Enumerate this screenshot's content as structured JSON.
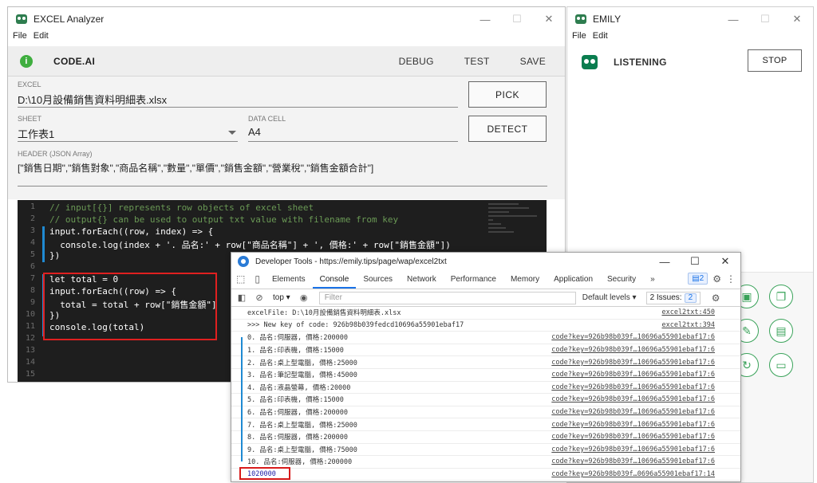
{
  "excel": {
    "title": "EXCEL Analyzer",
    "menu": [
      "File",
      "Edit"
    ],
    "toolbar": {
      "brand": "CODE.AI",
      "debug": "DEBUG",
      "test": "TEST",
      "save": "SAVE"
    },
    "form": {
      "excel_label": "EXCEL",
      "excel_value": "D:\\10月設備銷售資料明細表.xlsx",
      "sheet_label": "SHEET",
      "sheet_value": "工作表1",
      "datacell_label": "DATA CELL",
      "datacell_value": "A4",
      "header_label": "HEADER (JSON Array)",
      "header_value": "[\"銷售日期\",\"銷售對象\",\"商品名稱\",\"數量\",\"單價\",\"銷售金額\",\"營業稅\",\"銷售金額合計\"]",
      "pick_button": "PICK",
      "detect_button": "DETECT"
    },
    "code_lines": [
      "// input[{}] represents row objects of excel sheet",
      "// output{} can be used to output txt value with filename from key",
      "input.forEach((row, index) => {",
      "  console.log(index + '. 品名:' + row[\"商品名稱\"] + ', 價格:' + row[\"銷售金額\"])",
      "})",
      "",
      "let total = 0",
      "input.forEach((row) => {",
      "  total = total + row[\"銷售金額\"]",
      "})",
      "console.log(total)",
      "",
      "",
      "",
      ""
    ],
    "line_numbers": [
      "1",
      "2",
      "3",
      "4",
      "5",
      "6",
      "7",
      "8",
      "9",
      "10",
      "11",
      "12",
      "13",
      "14",
      "15"
    ]
  },
  "emily": {
    "title": "EMILY",
    "menu": [
      "File",
      "Edit"
    ],
    "status": "LISTENING",
    "stop_button": "STOP"
  },
  "devtools": {
    "title": "Developer Tools - https://emily.tips/page/wap/excel2txt",
    "tabs": [
      "Elements",
      "Console",
      "Sources",
      "Network",
      "Performance",
      "Memory",
      "Application",
      "Security"
    ],
    "more_tabs": "»",
    "issues_badge": "2",
    "context": "top",
    "filter_placeholder": "Filter",
    "levels": "Default levels",
    "issues_label": "2 Issues:",
    "issues_count": "2",
    "console": [
      {
        "msg": "excelFile: D:\\10月設備銷售資料明細表.xlsx",
        "src": "excel2txt:450"
      },
      {
        "msg": ">>> New key of code: 926b98b039fedcd10696a55901ebaf17",
        "src": "excel2txt:394"
      },
      {
        "msg": "0. 品名:伺服器, 價格:200000",
        "src": "code?key=926b98b039f…10696a55901ebaf17:6"
      },
      {
        "msg": "1. 品名:印表機, 價格:15000",
        "src": "code?key=926b98b039f…10696a55901ebaf17:6"
      },
      {
        "msg": "2. 品名:桌上型電腦, 價格:25000",
        "src": "code?key=926b98b039f…10696a55901ebaf17:6"
      },
      {
        "msg": "3. 品名:筆記型電腦, 價格:45000",
        "src": "code?key=926b98b039f…10696a55901ebaf17:6"
      },
      {
        "msg": "4. 品名:液晶螢幕, 價格:20000",
        "src": "code?key=926b98b039f…10696a55901ebaf17:6"
      },
      {
        "msg": "5. 品名:印表機, 價格:15000",
        "src": "code?key=926b98b039f…10696a55901ebaf17:6"
      },
      {
        "msg": "6. 品名:伺服器, 價格:200000",
        "src": "code?key=926b98b039f…10696a55901ebaf17:6"
      },
      {
        "msg": "7. 品名:桌上型電腦, 價格:25000",
        "src": "code?key=926b98b039f…10696a55901ebaf17:6"
      },
      {
        "msg": "8. 品名:伺服器, 價格:200000",
        "src": "code?key=926b98b039f…10696a55901ebaf17:6"
      },
      {
        "msg": "9. 品名:桌上型電腦, 價格:75000",
        "src": "code?key=926b98b039f…10696a55901ebaf17:6"
      },
      {
        "msg": "10. 品名:伺服器, 價格:200000",
        "src": "code?key=926b98b039f…10696a55901ebaf17:6"
      },
      {
        "msg": "1020000",
        "src": "code?key=926b98b039f…0696a55901ebaf17:14"
      }
    ]
  },
  "colors": {
    "accent": "#1a73e8",
    "brand_green": "#0a7d4f",
    "highlight_red": "#e02020"
  }
}
